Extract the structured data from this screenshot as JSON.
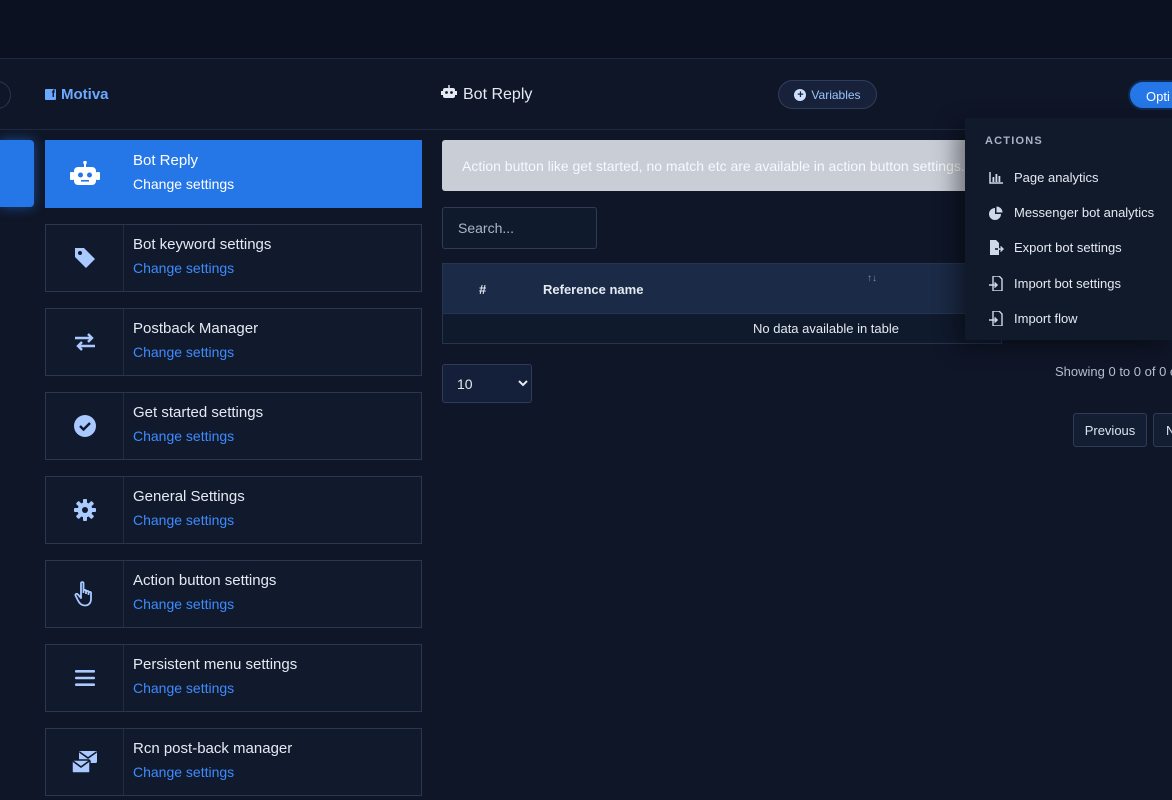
{
  "header": {
    "brand": "Motiva",
    "brand_icon": "facebook-icon",
    "page_title": "Bot Reply",
    "page_title_icon": "robot-icon",
    "variables_label": "Variables",
    "options_label": "Opti"
  },
  "nav": {
    "items": [
      {
        "title": "Bot Reply",
        "subtitle": "Change settings",
        "icon": "robot-icon"
      },
      {
        "title": "Bot keyword settings",
        "subtitle": "Change settings",
        "icon": "tag-icon"
      },
      {
        "title": "Postback Manager",
        "subtitle": "Change settings",
        "icon": "exchange-icon"
      },
      {
        "title": "Get started settings",
        "subtitle": "Change settings",
        "icon": "check-circle-icon"
      },
      {
        "title": "General Settings",
        "subtitle": "Change settings",
        "icon": "gear-icon"
      },
      {
        "title": "Action button settings",
        "subtitle": "Change settings",
        "icon": "hand-pointer-icon"
      },
      {
        "title": "Persistent menu settings",
        "subtitle": "Change settings",
        "icon": "bars-icon"
      },
      {
        "title": "Rcn post-back manager",
        "subtitle": "Change settings",
        "icon": "envelopes-icon"
      }
    ]
  },
  "main": {
    "alert_text": "Action button like get started, no match etc are available in action button settings.",
    "search_placeholder": "Search...",
    "table": {
      "columns": [
        "#",
        "Reference name"
      ],
      "empty_text": "No data available in table"
    },
    "page_size": "10",
    "showing_text": "Showing 0 to 0 of 0 e",
    "prev_label": "Previous",
    "next_label": "N"
  },
  "dropdown": {
    "header": "ACTIONS",
    "items": [
      {
        "label": "Page analytics",
        "icon": "bar-chart-icon"
      },
      {
        "label": "Messenger bot analytics",
        "icon": "pie-chart-icon"
      },
      {
        "label": "Export bot settings",
        "icon": "file-export-icon"
      },
      {
        "label": "Import bot settings",
        "icon": "file-import-icon"
      },
      {
        "label": "Import flow",
        "icon": "file-import-icon"
      }
    ]
  },
  "colors": {
    "background": "#0f1628",
    "accent": "#2577e8",
    "link": "#3d8bff"
  }
}
